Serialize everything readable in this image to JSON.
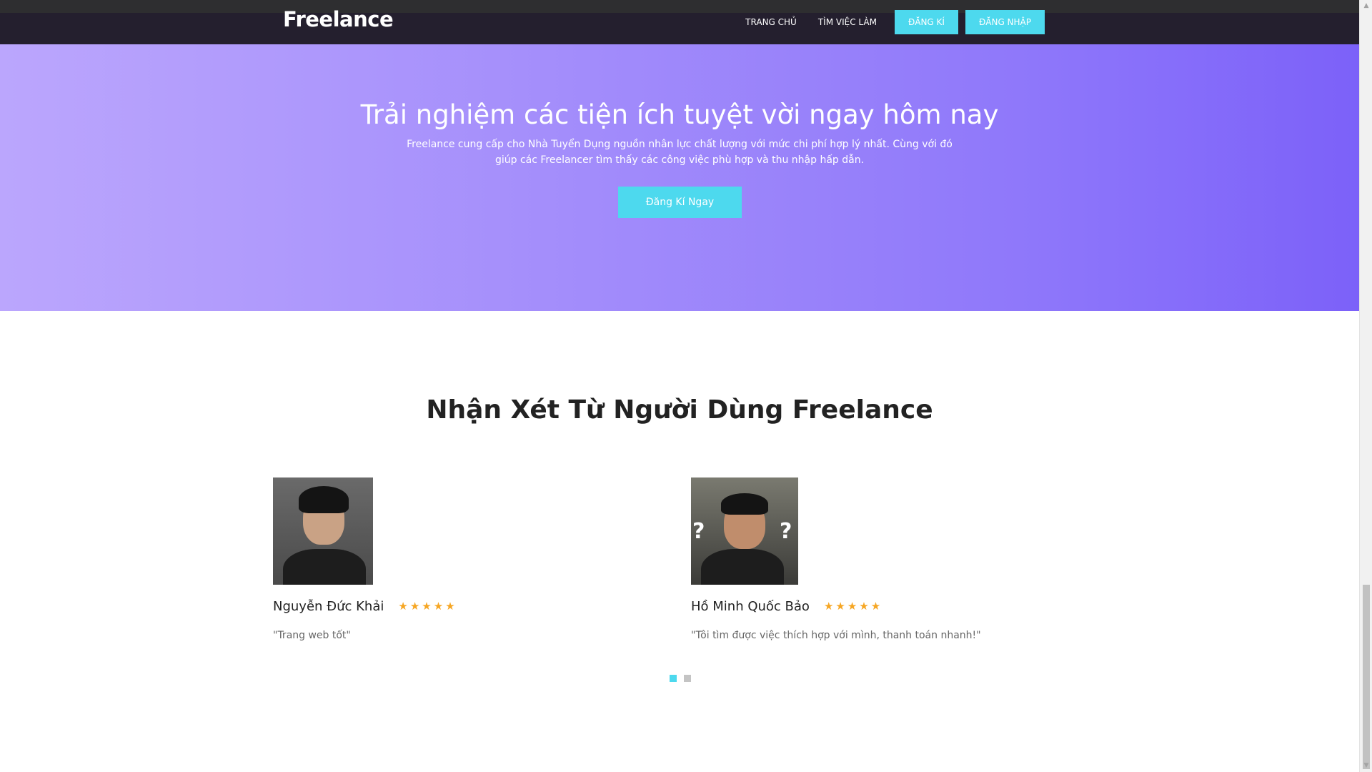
{
  "nav": {
    "brand": "Freelance",
    "links": [
      "TRANG CHỦ",
      "TÌM VIỆC LÀM"
    ],
    "register_label": "ĐĂNG KÍ",
    "login_label": "ĐĂNG NHẬP"
  },
  "hero": {
    "title": "Trải nghiệm các tiện ích tuyệt vời ngay hôm nay",
    "description": "Freelance cung cấp cho Nhà Tuyển Dụng nguồn nhân lực chất lượng với mức chi phí hợp lý nhất. Cùng với đó giúp các Freelancer tìm thấy các công việc phù hợp và thu nhập hấp dẫn.",
    "cta_label": "Đăng Kí Ngay"
  },
  "testimonials": {
    "title": "Nhận Xét Từ Người Dùng Freelance",
    "items": [
      {
        "name": "Nguyễn Đức Khải",
        "rating": 5,
        "quote": "\"Trang web tốt\""
      },
      {
        "name": "Hồ Minh Quốc Bảo",
        "rating": 5,
        "quote": "\"Tôi tìm được việc thích hợp với mình, thanh toán nhanh!\""
      }
    ],
    "carousel": {
      "pages": 2,
      "active": 1
    }
  },
  "colors": {
    "accent": "#4dd9ee",
    "nav_bg": "#241f2e",
    "hero_start": "#bba6fd",
    "hero_end": "#7c61f9",
    "star": "#f6a623"
  },
  "icons": {
    "star": "star-icon",
    "scroll_up": "scroll-up-arrow-icon",
    "scroll_down": "scroll-down-arrow-icon"
  }
}
